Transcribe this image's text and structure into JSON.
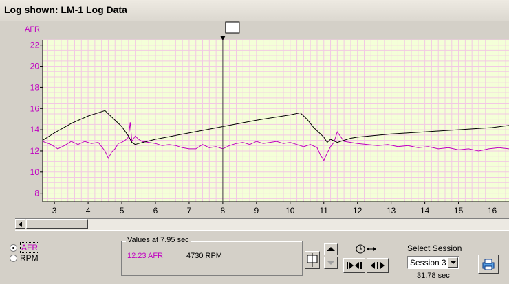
{
  "window": {
    "title": "Log shown: LM-1 Log Data"
  },
  "chart_data": {
    "type": "line",
    "y_axis_label": "AFR",
    "y_ticks": [
      8,
      10,
      12,
      14,
      16,
      18,
      20,
      22
    ],
    "x_ticks": [
      3,
      4,
      5,
      6,
      7,
      8,
      9,
      10,
      11,
      12,
      13,
      14,
      15,
      16
    ],
    "xlim": [
      2.65,
      16.5
    ],
    "ylim": [
      7.2,
      22.5
    ],
    "grid": true,
    "cursor_x": 8,
    "series": [
      {
        "name": "AFR",
        "color": "#c000c0",
        "x": [
          2.65,
          2.9,
          3.1,
          3.3,
          3.5,
          3.7,
          3.9,
          4.1,
          4.3,
          4.5,
          4.6,
          4.7,
          4.8,
          4.9,
          5.0,
          5.1,
          5.2,
          5.25,
          5.3,
          5.4,
          5.5,
          5.6,
          5.8,
          6.0,
          6.2,
          6.4,
          6.6,
          6.8,
          7.0,
          7.2,
          7.4,
          7.6,
          7.8,
          8.0,
          8.2,
          8.4,
          8.6,
          8.8,
          9.0,
          9.2,
          9.4,
          9.6,
          9.8,
          10.0,
          10.2,
          10.4,
          10.6,
          10.8,
          10.9,
          11.0,
          11.1,
          11.2,
          11.3,
          11.4,
          11.6,
          11.8,
          12.0,
          12.3,
          12.6,
          12.9,
          13.2,
          13.5,
          13.8,
          14.1,
          14.4,
          14.7,
          15.0,
          15.3,
          15.6,
          15.9,
          16.2,
          16.5
        ],
        "y": [
          12.9,
          12.6,
          12.2,
          12.5,
          12.9,
          12.6,
          12.9,
          12.7,
          12.8,
          12.0,
          11.3,
          11.9,
          12.2,
          12.7,
          12.8,
          13.0,
          13.3,
          14.7,
          12.9,
          13.4,
          13.1,
          12.9,
          12.8,
          12.7,
          12.5,
          12.6,
          12.5,
          12.3,
          12.2,
          12.2,
          12.6,
          12.3,
          12.4,
          12.2,
          12.5,
          12.7,
          12.8,
          12.6,
          12.9,
          12.7,
          12.8,
          12.9,
          12.7,
          12.8,
          12.6,
          12.4,
          12.6,
          12.3,
          11.6,
          11.1,
          11.8,
          12.4,
          12.8,
          13.8,
          12.9,
          12.8,
          12.7,
          12.6,
          12.5,
          12.6,
          12.4,
          12.5,
          12.3,
          12.4,
          12.2,
          12.3,
          12.1,
          12.2,
          12.0,
          12.2,
          12.3,
          12.2
        ]
      },
      {
        "name": "RPM",
        "color": "#000000",
        "x": [
          2.65,
          3.0,
          3.5,
          4.0,
          4.5,
          5.0,
          5.2,
          5.3,
          5.4,
          5.5,
          6.0,
          7.0,
          8.0,
          9.0,
          10.0,
          10.3,
          10.5,
          10.7,
          10.9,
          11.0,
          11.1,
          11.2,
          11.4,
          11.6,
          11.8,
          12.0,
          13.0,
          14.0,
          15.0,
          16.0,
          16.5
        ],
        "y": [
          13.0,
          13.7,
          14.6,
          15.3,
          15.8,
          14.3,
          13.4,
          12.8,
          12.6,
          12.7,
          13.1,
          13.7,
          14.3,
          14.9,
          15.4,
          15.6,
          15.0,
          14.2,
          13.6,
          13.3,
          12.8,
          13.1,
          12.8,
          13.0,
          13.2,
          13.3,
          13.6,
          13.8,
          14.0,
          14.2,
          14.4
        ]
      }
    ]
  },
  "legend": {
    "afr": "AFR",
    "rpm": "RPM"
  },
  "values": {
    "header": "Values at 7.95 sec",
    "afr": "12.23 AFR",
    "rpm": "4730 RPM"
  },
  "session": {
    "label": "Select Session",
    "selected": "Session 3",
    "duration": "31.78 sec"
  }
}
